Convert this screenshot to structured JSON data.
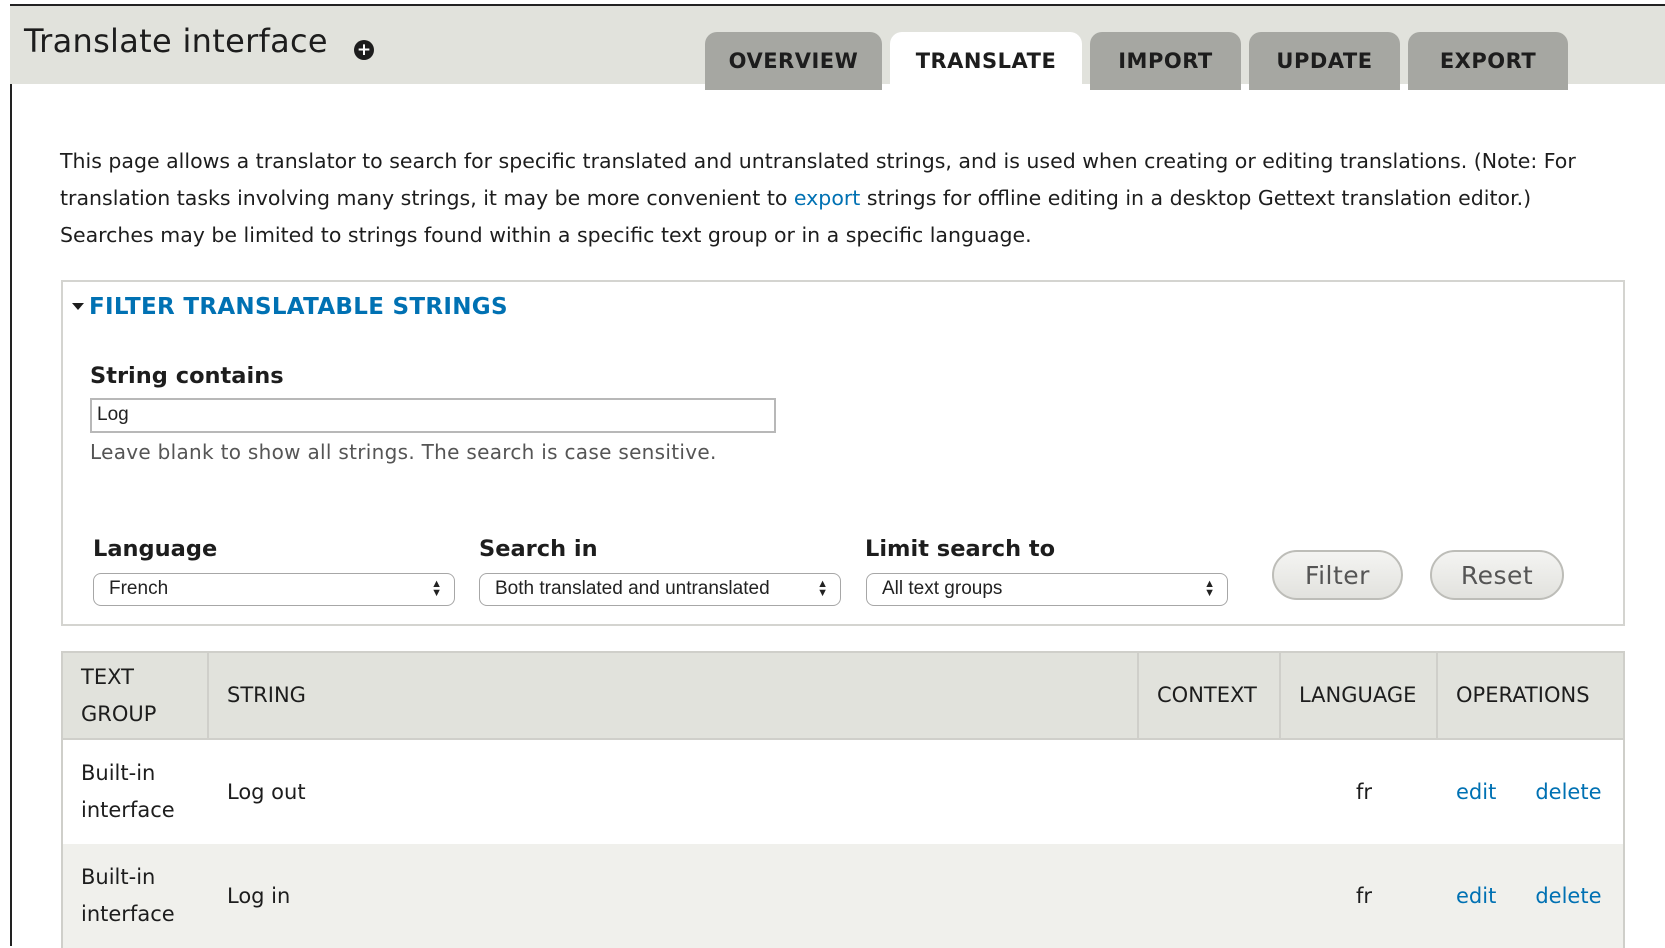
{
  "header": {
    "title": "Translate interface",
    "shortcut_icon": "plus-circle-icon",
    "tabs": [
      {
        "label": "OVERVIEW",
        "active": false
      },
      {
        "label": "TRANSLATE",
        "active": true
      },
      {
        "label": "IMPORT",
        "active": false
      },
      {
        "label": "UPDATE",
        "active": false
      },
      {
        "label": "EXPORT",
        "active": false
      }
    ]
  },
  "intro": {
    "before_link": "This page allows a translator to search for specific translated and untranslated strings, and is used when creating or editing translations. (Note: For translation tasks involving many strings, it may be more convenient to ",
    "link": "export",
    "after_link": " strings for offline editing in a desktop Gettext translation editor.) Searches may be limited to strings found within a specific text group or in a specific language."
  },
  "filter": {
    "legend": "FILTER TRANSLATABLE STRINGS",
    "string_label": "String contains",
    "string_value": "Log",
    "string_description": "Leave blank to show all strings. The search is case sensitive.",
    "language_label": "Language",
    "language_value": "French",
    "search_in_label": "Search in",
    "search_in_value": "Both translated and untranslated",
    "limit_label": "Limit search to",
    "limit_value": "All text groups",
    "filter_button": "Filter",
    "reset_button": "Reset"
  },
  "table": {
    "headers": {
      "text_group_1": "TEXT",
      "text_group_2": "GROUP",
      "string": "STRING",
      "context": "CONTEXT",
      "language": "LANGUAGE",
      "operations": "OPERATIONS"
    },
    "rows": [
      {
        "group_1": "Built-in",
        "group_2": "interface",
        "string": "Log out",
        "context": "",
        "language": "fr",
        "edit": "edit",
        "delete": "delete"
      },
      {
        "group_1": "Built-in",
        "group_2": "interface",
        "string": "Log in",
        "context": "",
        "language": "fr",
        "edit": "edit",
        "delete": "delete"
      }
    ]
  },
  "colors": {
    "link": "#0071b3",
    "header_bg": "#e1e2dc",
    "tab_inactive": "#a6a7a2"
  }
}
